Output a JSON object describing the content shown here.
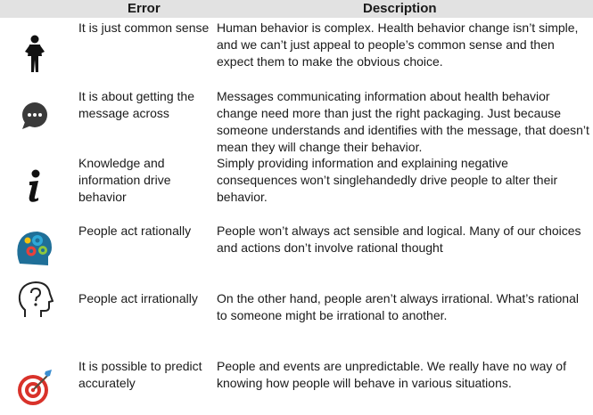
{
  "header": {
    "error": "Error",
    "description": "Description"
  },
  "rows": [
    {
      "icon": "person-standing-icon",
      "error": "It is just common sense",
      "description": "Human behavior is complex.  Health behavior change isn’t simple, and we can’t just appeal to people’s common sense and then expect them to make the obvious choice."
    },
    {
      "icon": "speech-bubble-icon",
      "error": "It is about getting the message across",
      "description": "Messages communicating information about health behavior change need more than just the right packaging. Just because someone understands and identifies with the message, that doesn’t mean they will change their behavior."
    },
    {
      "icon": "info-icon",
      "error": "Knowledge and information drive behavior",
      "description": "Simply providing information and explaining negative consequences won’t singlehandedly drive people to alter their behavior."
    },
    {
      "icon": "head-gears-icon",
      "error": "People act rationally",
      "description": "People won’t always act sensible and logical. Many of our choices and actions don’t involve rational thought"
    },
    {
      "icon": "head-question-icon",
      "error": "People act irrationally",
      "description": "On the other hand, people aren’t always irrational.  What’s rational to someone might be irrational to another."
    },
    {
      "icon": "target-arrow-icon",
      "error": "It is possible to predict accurately",
      "description": "People and events are unpredictable.  We really have no way of knowing how people will behave in various situations."
    }
  ]
}
